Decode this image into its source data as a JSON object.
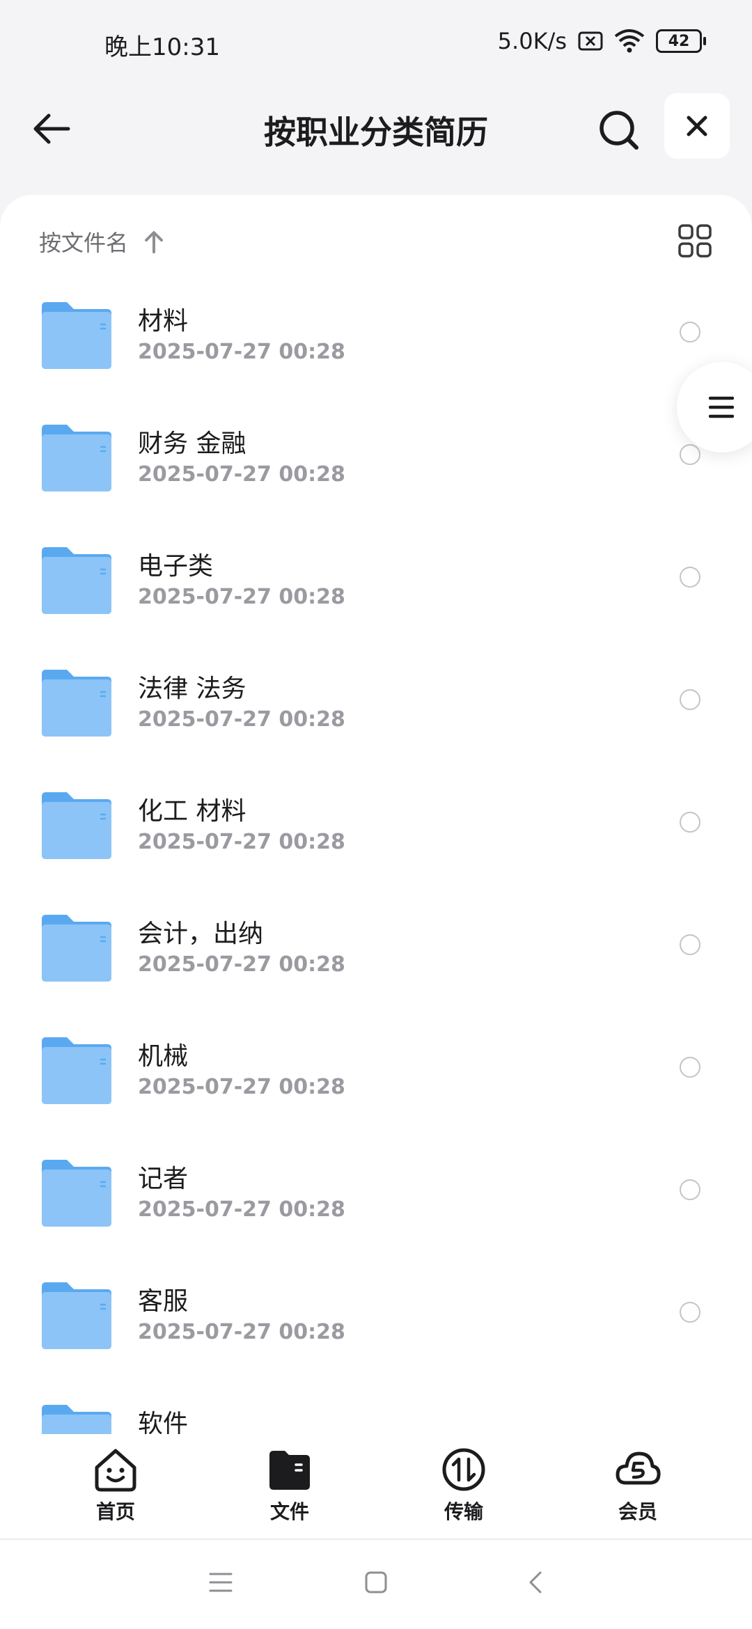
{
  "status_bar": {
    "time": "晚上10:31",
    "network_speed": "5.0K/s",
    "battery": "42"
  },
  "header": {
    "title": "按职业分类简历"
  },
  "sort": {
    "label": "按文件名"
  },
  "files": [
    {
      "name": "材料",
      "date": "2025-07-27 00:28"
    },
    {
      "name": "财务 金融",
      "date": "2025-07-27 00:28"
    },
    {
      "name": "电子类",
      "date": "2025-07-27 00:28"
    },
    {
      "name": "法律 法务",
      "date": "2025-07-27 00:28"
    },
    {
      "name": "化工 材料",
      "date": "2025-07-27 00:28"
    },
    {
      "name": "会计，出纳",
      "date": "2025-07-27 00:28"
    },
    {
      "name": "机械",
      "date": "2025-07-27 00:28"
    },
    {
      "name": "记者",
      "date": "2025-07-27 00:28"
    },
    {
      "name": "客服",
      "date": "2025-07-27 00:28"
    },
    {
      "name": "软件",
      "date": ""
    }
  ],
  "bottom_nav": [
    {
      "label": "首页",
      "icon": "home-smile-icon"
    },
    {
      "label": "文件",
      "icon": "folder-icon"
    },
    {
      "label": "传输",
      "icon": "transfer-icon"
    },
    {
      "label": "会员",
      "icon": "cloud-member-icon"
    }
  ],
  "colors": {
    "folder": "#6cb4f5",
    "folder_light": "#a9d4fb",
    "background": "#f4f4f6"
  }
}
